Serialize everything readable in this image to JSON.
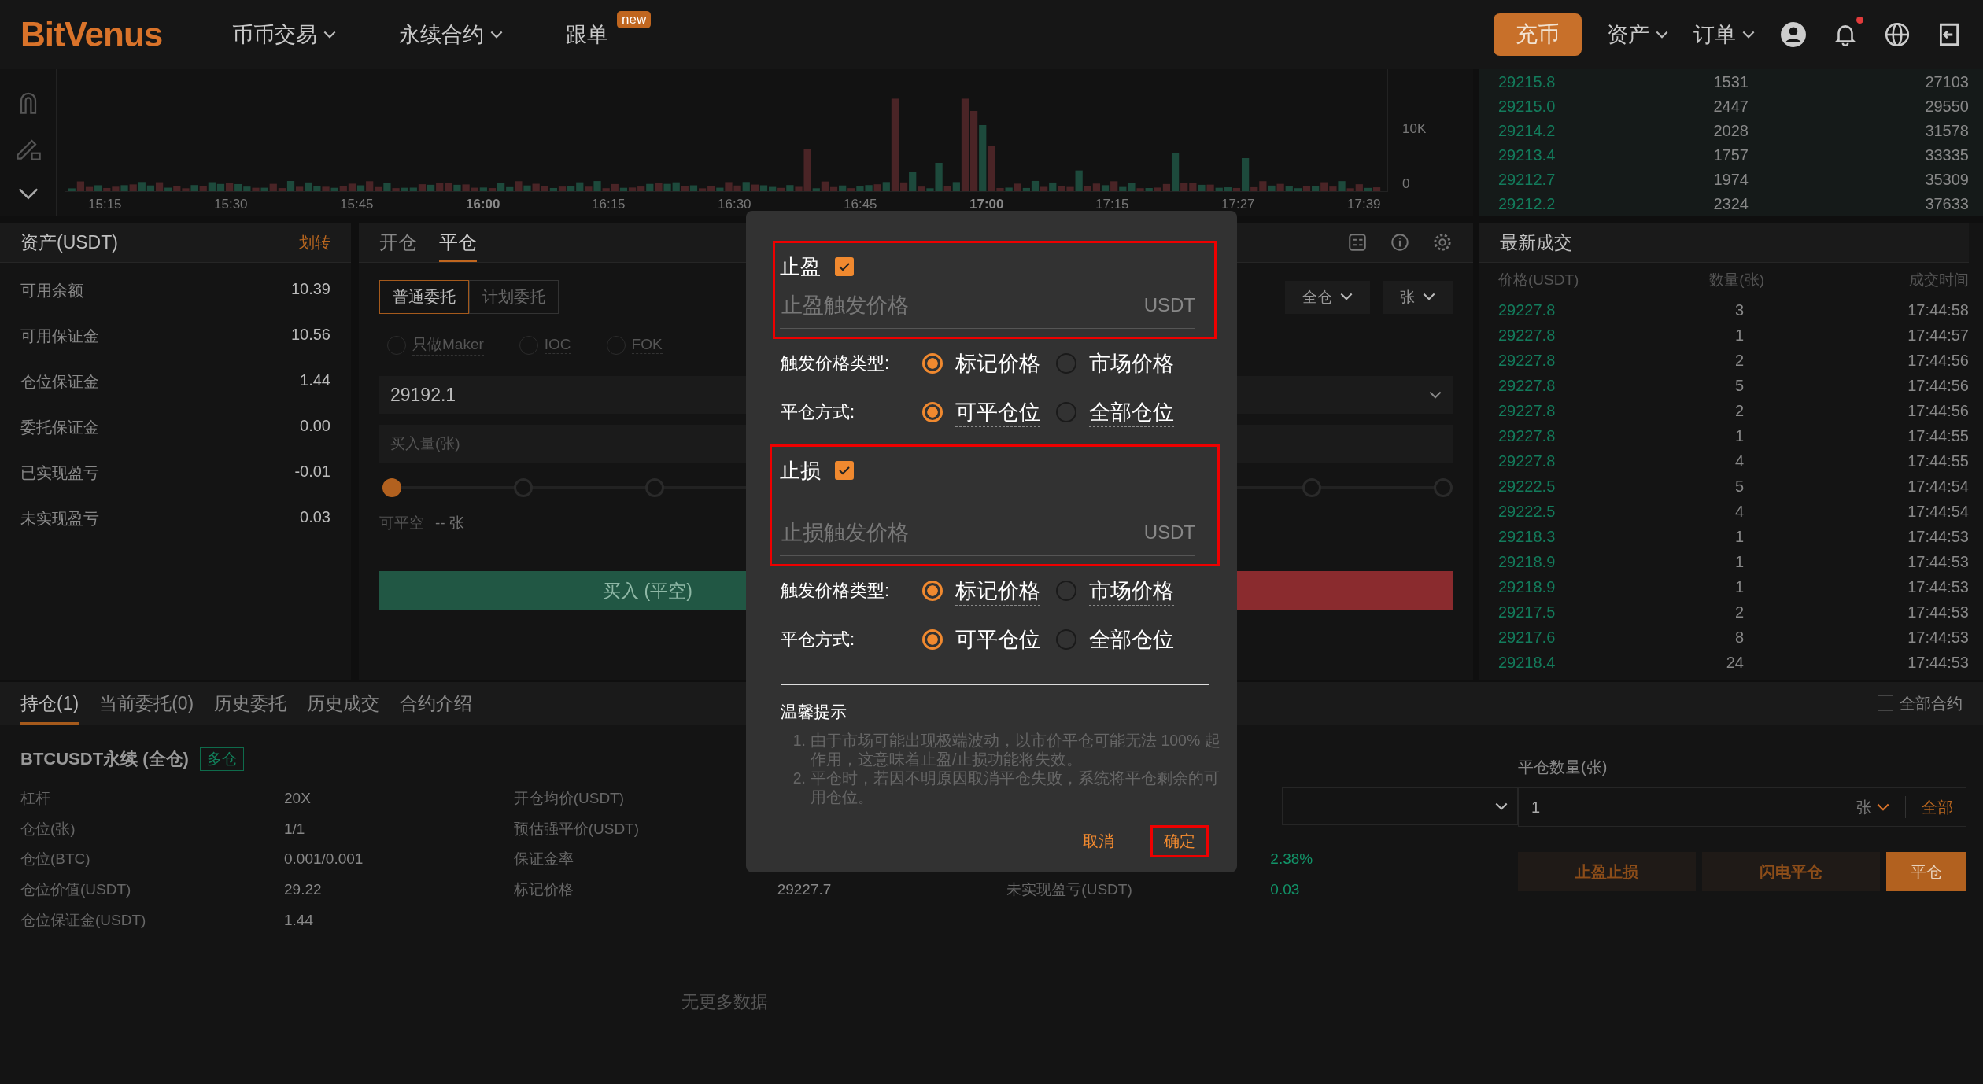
{
  "header": {
    "logo": "BitVenus",
    "nav": [
      {
        "label": "币币交易",
        "dropdown": true
      },
      {
        "label": "永续合约",
        "dropdown": true
      },
      {
        "label": "跟单",
        "dropdown": false,
        "badge": "new"
      }
    ],
    "deposit": "充币",
    "menus": [
      "资产",
      "订单"
    ],
    "notification_dot": true
  },
  "chart": {
    "y_ticks": [
      "10K",
      "0"
    ],
    "x_labels": [
      {
        "label": "15:15",
        "bold": false
      },
      {
        "label": "15:30",
        "bold": false
      },
      {
        "label": "15:45",
        "bold": false
      },
      {
        "label": "16:00",
        "bold": true
      },
      {
        "label": "16:15",
        "bold": false
      },
      {
        "label": "16:30",
        "bold": false
      },
      {
        "label": "16:45",
        "bold": false
      },
      {
        "label": "17:00",
        "bold": true
      },
      {
        "label": "17:15",
        "bold": false
      },
      {
        "label": "17:27",
        "bold": false
      },
      {
        "label": "17:39",
        "bold": false
      }
    ]
  },
  "order_book": {
    "asks": [
      {
        "price": "29215.8",
        "amount": "1531",
        "total": "27103"
      },
      {
        "price": "29215.0",
        "amount": "2447",
        "total": "29550"
      },
      {
        "price": "29214.2",
        "amount": "2028",
        "total": "31578"
      },
      {
        "price": "29213.4",
        "amount": "1757",
        "total": "33335"
      },
      {
        "price": "29212.7",
        "amount": "1974",
        "total": "35309"
      },
      {
        "price": "29212.2",
        "amount": "2324",
        "total": "37633"
      }
    ]
  },
  "assets": {
    "title": "资产(USDT)",
    "transfer": "划转",
    "rows": [
      {
        "label": "可用余额",
        "value": "10.39"
      },
      {
        "label": "可用保证金",
        "value": "10.56"
      },
      {
        "label": "仓位保证金",
        "value": "1.44"
      },
      {
        "label": "委托保证金",
        "value": "0.00"
      },
      {
        "label": "已实现盈亏",
        "value": "-0.01"
      },
      {
        "label": "未实现盈亏",
        "value": "0.03"
      }
    ]
  },
  "order_panel": {
    "tabs": [
      {
        "label": "开仓",
        "selected": false
      },
      {
        "label": "平仓",
        "selected": true
      }
    ],
    "order_types": [
      {
        "label": "普通委托",
        "selected": true
      },
      {
        "label": "计划委托",
        "selected": false
      }
    ],
    "options": [
      {
        "label": "只做Maker",
        "selected": false
      },
      {
        "label": "IOC",
        "selected": false
      },
      {
        "label": "FOK",
        "selected": false
      }
    ],
    "margin_mode": "全仓",
    "unit": "张",
    "price": "29192.1",
    "amount_placeholder": "买入量(张)",
    "slider": {
      "level": 0
    },
    "available_label": "可平空",
    "available_value": "-- 张",
    "buy_button": "买入 (平空)"
  },
  "trades": {
    "title": "最新成交",
    "columns": [
      "价格(USDT)",
      "数量(张)",
      "成交时间"
    ],
    "rows": [
      {
        "price": "29227.8",
        "amount": "3",
        "time": "17:44:58"
      },
      {
        "price": "29227.8",
        "amount": "1",
        "time": "17:44:57"
      },
      {
        "price": "29227.8",
        "amount": "2",
        "time": "17:44:56"
      },
      {
        "price": "29227.8",
        "amount": "5",
        "time": "17:44:56"
      },
      {
        "price": "29227.8",
        "amount": "2",
        "time": "17:44:56"
      },
      {
        "price": "29227.8",
        "amount": "1",
        "time": "17:44:55"
      },
      {
        "price": "29227.8",
        "amount": "4",
        "time": "17:44:55"
      },
      {
        "price": "29222.5",
        "amount": "5",
        "time": "17:44:54"
      },
      {
        "price": "29222.5",
        "amount": "4",
        "time": "17:44:54"
      },
      {
        "price": "29218.3",
        "amount": "1",
        "time": "17:44:53"
      },
      {
        "price": "29218.9",
        "amount": "1",
        "time": "17:44:53"
      },
      {
        "price": "29218.9",
        "amount": "1",
        "time": "17:44:53"
      },
      {
        "price": "29217.5",
        "amount": "2",
        "time": "17:44:53"
      },
      {
        "price": "29217.6",
        "amount": "8",
        "time": "17:44:53"
      },
      {
        "price": "29218.4",
        "amount": "24",
        "time": "17:44:53"
      }
    ]
  },
  "positions": {
    "tabs": [
      {
        "label": "持仓(1)",
        "selected": true
      },
      {
        "label": "当前委托(0)",
        "selected": false
      },
      {
        "label": "历史委托",
        "selected": false
      },
      {
        "label": "历史成交",
        "selected": false
      },
      {
        "label": "合约介绍",
        "selected": false
      }
    ],
    "all_contracts": {
      "label": "全部合约",
      "checked": false
    },
    "title": "BTCUSDT永续 (全仓)",
    "side_tag": "多仓",
    "columns": [
      [
        {
          "label": "杠杆",
          "value": "20X",
          "positive": false
        },
        {
          "label": "仓位(张)",
          "value": "1/1",
          "positive": false
        },
        {
          "label": "仓位(BTC)",
          "value": "0.001/0.001",
          "positive": false
        },
        {
          "label": "仓位价值(USDT)",
          "value": "29.22",
          "positive": false
        },
        {
          "label": "仓位保证金(USDT)",
          "value": "1.44",
          "positive": false
        }
      ],
      [
        {
          "label": "开仓均价(USDT)"
        },
        {
          "label": "预估强平价(USDT)"
        },
        {
          "label": "保证金率"
        },
        {
          "label": "标记价格",
          "value": "29227.7",
          "positive": false
        }
      ],
      [
        {
          "value": "2.38%",
          "positive": true
        },
        {
          "label": "未实现盈亏(USDT)",
          "value": "0.03",
          "positive": true
        }
      ]
    ],
    "close_qty_label": "平仓数量(张)",
    "close_qty": "1",
    "close_unit": "张",
    "close_all": "全部",
    "actions": [
      {
        "label": "止盈止损",
        "kind": "dark"
      },
      {
        "label": "闪电平仓",
        "kind": "dark"
      },
      {
        "label": "平仓",
        "kind": "primary"
      }
    ],
    "empty": "无更多数据"
  },
  "modal": {
    "sections": [
      {
        "title": "止盈",
        "checked": true,
        "placeholder": "止盈触发价格",
        "unit": "USDT",
        "trigger_label": "触发价格类型:",
        "trigger_options": [
          {
            "label": "标记价格",
            "selected": true
          },
          {
            "label": "市场价格",
            "selected": false
          }
        ],
        "close_label": "平仓方式:",
        "close_options": [
          {
            "label": "可平仓位",
            "selected": true
          },
          {
            "label": "全部仓位",
            "selected": false
          }
        ]
      },
      {
        "title": "止损",
        "checked": true,
        "placeholder": "止损触发价格",
        "unit": "USDT",
        "trigger_label": "触发价格类型:",
        "trigger_options": [
          {
            "label": "标记价格",
            "selected": true
          },
          {
            "label": "市场价格",
            "selected": false
          }
        ],
        "close_label": "平仓方式:",
        "close_options": [
          {
            "label": "可平仓位",
            "selected": true
          },
          {
            "label": "全部仓位",
            "selected": false
          }
        ]
      }
    ],
    "tips_title": "温馨提示",
    "tips": [
      {
        "number": "1.",
        "text": "由于市场可能出现极端波动，以市价平仓可能无法 100% 起作用，这意味着止盈/止损功能将失效。"
      },
      {
        "number": "2.",
        "text": "平仓时，若因不明原因取消平仓失败，系统将平仓剩余的可用仓位。"
      }
    ],
    "cancel": "取消",
    "confirm": "确定"
  }
}
